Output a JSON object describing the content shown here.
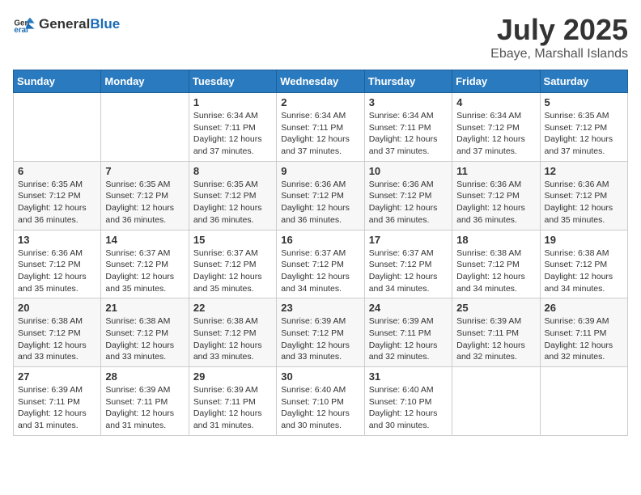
{
  "logo": {
    "general": "General",
    "blue": "Blue"
  },
  "header": {
    "month": "July 2025",
    "location": "Ebaye, Marshall Islands"
  },
  "days_of_week": [
    "Sunday",
    "Monday",
    "Tuesday",
    "Wednesday",
    "Thursday",
    "Friday",
    "Saturday"
  ],
  "weeks": [
    [
      {
        "day": null,
        "info": null
      },
      {
        "day": null,
        "info": null
      },
      {
        "day": "1",
        "info": "Sunrise: 6:34 AM\nSunset: 7:11 PM\nDaylight: 12 hours and 37 minutes."
      },
      {
        "day": "2",
        "info": "Sunrise: 6:34 AM\nSunset: 7:11 PM\nDaylight: 12 hours and 37 minutes."
      },
      {
        "day": "3",
        "info": "Sunrise: 6:34 AM\nSunset: 7:11 PM\nDaylight: 12 hours and 37 minutes."
      },
      {
        "day": "4",
        "info": "Sunrise: 6:34 AM\nSunset: 7:12 PM\nDaylight: 12 hours and 37 minutes."
      },
      {
        "day": "5",
        "info": "Sunrise: 6:35 AM\nSunset: 7:12 PM\nDaylight: 12 hours and 37 minutes."
      }
    ],
    [
      {
        "day": "6",
        "info": "Sunrise: 6:35 AM\nSunset: 7:12 PM\nDaylight: 12 hours and 36 minutes."
      },
      {
        "day": "7",
        "info": "Sunrise: 6:35 AM\nSunset: 7:12 PM\nDaylight: 12 hours and 36 minutes."
      },
      {
        "day": "8",
        "info": "Sunrise: 6:35 AM\nSunset: 7:12 PM\nDaylight: 12 hours and 36 minutes."
      },
      {
        "day": "9",
        "info": "Sunrise: 6:36 AM\nSunset: 7:12 PM\nDaylight: 12 hours and 36 minutes."
      },
      {
        "day": "10",
        "info": "Sunrise: 6:36 AM\nSunset: 7:12 PM\nDaylight: 12 hours and 36 minutes."
      },
      {
        "day": "11",
        "info": "Sunrise: 6:36 AM\nSunset: 7:12 PM\nDaylight: 12 hours and 36 minutes."
      },
      {
        "day": "12",
        "info": "Sunrise: 6:36 AM\nSunset: 7:12 PM\nDaylight: 12 hours and 35 minutes."
      }
    ],
    [
      {
        "day": "13",
        "info": "Sunrise: 6:36 AM\nSunset: 7:12 PM\nDaylight: 12 hours and 35 minutes."
      },
      {
        "day": "14",
        "info": "Sunrise: 6:37 AM\nSunset: 7:12 PM\nDaylight: 12 hours and 35 minutes."
      },
      {
        "day": "15",
        "info": "Sunrise: 6:37 AM\nSunset: 7:12 PM\nDaylight: 12 hours and 35 minutes."
      },
      {
        "day": "16",
        "info": "Sunrise: 6:37 AM\nSunset: 7:12 PM\nDaylight: 12 hours and 34 minutes."
      },
      {
        "day": "17",
        "info": "Sunrise: 6:37 AM\nSunset: 7:12 PM\nDaylight: 12 hours and 34 minutes."
      },
      {
        "day": "18",
        "info": "Sunrise: 6:38 AM\nSunset: 7:12 PM\nDaylight: 12 hours and 34 minutes."
      },
      {
        "day": "19",
        "info": "Sunrise: 6:38 AM\nSunset: 7:12 PM\nDaylight: 12 hours and 34 minutes."
      }
    ],
    [
      {
        "day": "20",
        "info": "Sunrise: 6:38 AM\nSunset: 7:12 PM\nDaylight: 12 hours and 33 minutes."
      },
      {
        "day": "21",
        "info": "Sunrise: 6:38 AM\nSunset: 7:12 PM\nDaylight: 12 hours and 33 minutes."
      },
      {
        "day": "22",
        "info": "Sunrise: 6:38 AM\nSunset: 7:12 PM\nDaylight: 12 hours and 33 minutes."
      },
      {
        "day": "23",
        "info": "Sunrise: 6:39 AM\nSunset: 7:12 PM\nDaylight: 12 hours and 33 minutes."
      },
      {
        "day": "24",
        "info": "Sunrise: 6:39 AM\nSunset: 7:11 PM\nDaylight: 12 hours and 32 minutes."
      },
      {
        "day": "25",
        "info": "Sunrise: 6:39 AM\nSunset: 7:11 PM\nDaylight: 12 hours and 32 minutes."
      },
      {
        "day": "26",
        "info": "Sunrise: 6:39 AM\nSunset: 7:11 PM\nDaylight: 12 hours and 32 minutes."
      }
    ],
    [
      {
        "day": "27",
        "info": "Sunrise: 6:39 AM\nSunset: 7:11 PM\nDaylight: 12 hours and 31 minutes."
      },
      {
        "day": "28",
        "info": "Sunrise: 6:39 AM\nSunset: 7:11 PM\nDaylight: 12 hours and 31 minutes."
      },
      {
        "day": "29",
        "info": "Sunrise: 6:39 AM\nSunset: 7:11 PM\nDaylight: 12 hours and 31 minutes."
      },
      {
        "day": "30",
        "info": "Sunrise: 6:40 AM\nSunset: 7:10 PM\nDaylight: 12 hours and 30 minutes."
      },
      {
        "day": "31",
        "info": "Sunrise: 6:40 AM\nSunset: 7:10 PM\nDaylight: 12 hours and 30 minutes."
      },
      {
        "day": null,
        "info": null
      },
      {
        "day": null,
        "info": null
      }
    ]
  ]
}
